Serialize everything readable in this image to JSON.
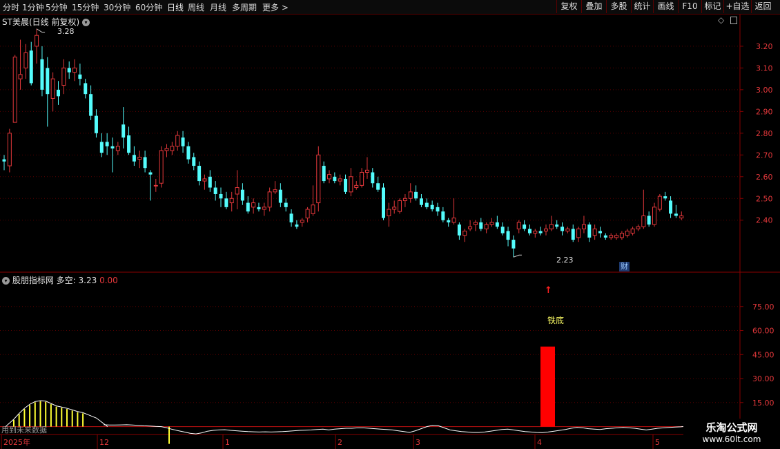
{
  "toolbar": {
    "timeframes": [
      "分时",
      "1分钟",
      "5分钟",
      "15分钟",
      "30分钟",
      "60分钟",
      "日线",
      "周线",
      "月线",
      "多周期",
      "更多 >"
    ],
    "active_timeframe": "日线",
    "right_buttons": [
      "复权",
      "叠加",
      "多股",
      "统计",
      "画线",
      "F10",
      "标记",
      "+自选",
      "返回"
    ]
  },
  "main_panel": {
    "title": "ST美晨(日线 前复权)",
    "price_axis_ticks": [
      "3.20",
      "3.10",
      "3.00",
      "2.90",
      "2.80",
      "2.70",
      "2.60",
      "2.50",
      "2.40"
    ],
    "high_marker": "3.28",
    "low_marker": "2.23",
    "event_badge": "财"
  },
  "indicator_panel": {
    "name": "股朋指标网",
    "series_label": "多空:",
    "value1": "3.23",
    "value2": "0.00",
    "axis_ticks": [
      "75.00",
      "60.00",
      "45.00",
      "30.00",
      "15.00"
    ],
    "signal_label": "铁底",
    "footer_note": "用到未来数据"
  },
  "date_axis": {
    "labels": [
      "2025年",
      "12",
      "1",
      "2",
      "3",
      "4",
      "5"
    ]
  },
  "watermark": {
    "name": "乐淘公式网",
    "url": "www.60lt.com"
  },
  "colors": {
    "up": "#e5383b",
    "down": "#54fcfc",
    "signal_bar": "#ff0000",
    "hist": "#ffff33",
    "line": "#ffffff",
    "grid": "#5a0000",
    "active": "#ffffff"
  },
  "chart_data": {
    "type": "candlestick",
    "ylim": [
      2.18,
      3.33
    ],
    "ohlc": [
      [
        2.68,
        2.7,
        2.63,
        2.67
      ],
      [
        2.65,
        2.82,
        2.62,
        2.8
      ],
      [
        2.85,
        3.16,
        2.85,
        3.15
      ],
      [
        3.05,
        3.23,
        3.0,
        3.07
      ],
      [
        3.1,
        3.21,
        3.05,
        3.17
      ],
      [
        3.18,
        3.22,
        3.02,
        3.03
      ],
      [
        3.2,
        3.28,
        3.12,
        3.25
      ],
      [
        3.14,
        3.2,
        2.97,
        3.0
      ],
      [
        3.1,
        3.15,
        2.83,
        2.98
      ],
      [
        2.96,
        3.08,
        2.9,
        3.05
      ],
      [
        3.0,
        3.04,
        2.93,
        2.97
      ],
      [
        3.02,
        3.14,
        2.98,
        3.1
      ],
      [
        3.1,
        3.13,
        3.05,
        3.08
      ],
      [
        3.08,
        3.14,
        3.04,
        3.1
      ],
      [
        3.07,
        3.12,
        3.02,
        3.05
      ],
      [
        3.03,
        3.05,
        2.96,
        2.98
      ],
      [
        2.98,
        3.02,
        2.86,
        2.88
      ],
      [
        2.88,
        2.91,
        2.78,
        2.8
      ],
      [
        2.76,
        2.8,
        2.69,
        2.71
      ],
      [
        2.76,
        2.8,
        2.7,
        2.74
      ],
      [
        2.74,
        2.78,
        2.62,
        2.73
      ],
      [
        2.72,
        2.76,
        2.7,
        2.74
      ],
      [
        2.84,
        2.92,
        2.73,
        2.78
      ],
      [
        2.79,
        2.83,
        2.7,
        2.71
      ],
      [
        2.7,
        2.74,
        2.65,
        2.67
      ],
      [
        2.68,
        2.72,
        2.64,
        2.69
      ],
      [
        2.69,
        2.72,
        2.62,
        2.64
      ],
      [
        2.62,
        2.63,
        2.49,
        2.61
      ],
      [
        2.56,
        2.59,
        2.53,
        2.56
      ],
      [
        2.57,
        2.74,
        2.55,
        2.72
      ],
      [
        2.72,
        2.75,
        2.69,
        2.73
      ],
      [
        2.72,
        2.76,
        2.7,
        2.74
      ],
      [
        2.74,
        2.81,
        2.72,
        2.79
      ],
      [
        2.78,
        2.81,
        2.71,
        2.74
      ],
      [
        2.74,
        2.76,
        2.66,
        2.68
      ],
      [
        2.69,
        2.71,
        2.63,
        2.65
      ],
      [
        2.65,
        2.67,
        2.56,
        2.58
      ],
      [
        2.58,
        2.61,
        2.54,
        2.59
      ],
      [
        2.6,
        2.63,
        2.53,
        2.55
      ],
      [
        2.55,
        2.58,
        2.49,
        2.52
      ],
      [
        2.52,
        2.55,
        2.46,
        2.5
      ],
      [
        2.5,
        2.53,
        2.45,
        2.46
      ],
      [
        2.48,
        2.53,
        2.44,
        2.5
      ],
      [
        2.52,
        2.63,
        2.45,
        2.55
      ],
      [
        2.54,
        2.57,
        2.47,
        2.49
      ],
      [
        2.48,
        2.51,
        2.43,
        2.44
      ],
      [
        2.46,
        2.5,
        2.43,
        2.48
      ],
      [
        2.46,
        2.48,
        2.44,
        2.45
      ],
      [
        2.45,
        2.48,
        2.42,
        2.46
      ],
      [
        2.46,
        2.55,
        2.44,
        2.53
      ],
      [
        2.53,
        2.58,
        2.52,
        2.54
      ],
      [
        2.54,
        2.57,
        2.46,
        2.48
      ],
      [
        2.48,
        2.5,
        2.44,
        2.46
      ],
      [
        2.43,
        2.45,
        2.37,
        2.39
      ],
      [
        2.38,
        2.4,
        2.36,
        2.37
      ],
      [
        2.39,
        2.41,
        2.37,
        2.4
      ],
      [
        2.41,
        2.46,
        2.39,
        2.45
      ],
      [
        2.43,
        2.56,
        2.42,
        2.47
      ],
      [
        2.48,
        2.74,
        2.44,
        2.7
      ],
      [
        2.65,
        2.67,
        2.57,
        2.58
      ],
      [
        2.59,
        2.63,
        2.57,
        2.61
      ],
      [
        2.6,
        2.62,
        2.57,
        2.58
      ],
      [
        2.58,
        2.61,
        2.56,
        2.59
      ],
      [
        2.59,
        2.61,
        2.52,
        2.53
      ],
      [
        2.53,
        2.64,
        2.51,
        2.6
      ],
      [
        2.55,
        2.58,
        2.54,
        2.56
      ],
      [
        2.56,
        2.64,
        2.55,
        2.62
      ],
      [
        2.62,
        2.69,
        2.59,
        2.63
      ],
      [
        2.62,
        2.64,
        2.55,
        2.57
      ],
      [
        2.57,
        2.6,
        2.53,
        2.54
      ],
      [
        2.55,
        2.57,
        2.4,
        2.41
      ],
      [
        2.42,
        2.48,
        2.37,
        2.45
      ],
      [
        2.45,
        2.49,
        2.43,
        2.46
      ],
      [
        2.44,
        2.5,
        2.43,
        2.49
      ],
      [
        2.49,
        2.52,
        2.46,
        2.5
      ],
      [
        2.5,
        2.57,
        2.48,
        2.53
      ],
      [
        2.53,
        2.56,
        2.49,
        2.5
      ],
      [
        2.5,
        2.52,
        2.46,
        2.47
      ],
      [
        2.48,
        2.5,
        2.45,
        2.46
      ],
      [
        2.47,
        2.49,
        2.44,
        2.45
      ],
      [
        2.46,
        2.48,
        2.42,
        2.44
      ],
      [
        2.44,
        2.46,
        2.39,
        2.4
      ],
      [
        2.4,
        2.41,
        2.37,
        2.39
      ],
      [
        2.39,
        2.5,
        2.38,
        2.41
      ],
      [
        2.38,
        2.39,
        2.31,
        2.33
      ],
      [
        2.33,
        2.36,
        2.3,
        2.35
      ],
      [
        2.36,
        2.4,
        2.35,
        2.37
      ],
      [
        2.38,
        2.4,
        2.35,
        2.39
      ],
      [
        2.39,
        2.41,
        2.35,
        2.36
      ],
      [
        2.36,
        2.39,
        2.34,
        2.38
      ],
      [
        2.38,
        2.41,
        2.37,
        2.39
      ],
      [
        2.39,
        2.42,
        2.36,
        2.37
      ],
      [
        2.37,
        2.39,
        2.33,
        2.34
      ],
      [
        2.35,
        2.37,
        2.28,
        2.31
      ],
      [
        2.31,
        2.33,
        2.23,
        2.27
      ],
      [
        2.36,
        2.4,
        2.34,
        2.39
      ],
      [
        2.38,
        2.4,
        2.35,
        2.36
      ],
      [
        2.36,
        2.38,
        2.33,
        2.34
      ],
      [
        2.34,
        2.36,
        2.32,
        2.35
      ],
      [
        2.35,
        2.37,
        2.33,
        2.34
      ],
      [
        2.35,
        2.38,
        2.33,
        2.36
      ],
      [
        2.36,
        2.42,
        2.35,
        2.38
      ],
      [
        2.38,
        2.4,
        2.36,
        2.37
      ],
      [
        2.37,
        2.39,
        2.33,
        2.35
      ],
      [
        2.35,
        2.37,
        2.34,
        2.36
      ],
      [
        2.36,
        2.38,
        2.3,
        2.31
      ],
      [
        2.32,
        2.37,
        2.3,
        2.36
      ],
      [
        2.36,
        2.42,
        2.34,
        2.38
      ],
      [
        2.38,
        2.39,
        2.3,
        2.32
      ],
      [
        2.33,
        2.38,
        2.31,
        2.36
      ],
      [
        2.35,
        2.37,
        2.32,
        2.34
      ],
      [
        2.33,
        2.34,
        2.31,
        2.32
      ],
      [
        2.32,
        2.34,
        2.31,
        2.33
      ],
      [
        2.32,
        2.34,
        2.31,
        2.33
      ],
      [
        2.32,
        2.35,
        2.31,
        2.34
      ],
      [
        2.33,
        2.36,
        2.32,
        2.35
      ],
      [
        2.34,
        2.37,
        2.33,
        2.36
      ],
      [
        2.36,
        2.38,
        2.35,
        2.37
      ],
      [
        2.37,
        2.54,
        2.36,
        2.42
      ],
      [
        2.42,
        2.44,
        2.37,
        2.38
      ],
      [
        2.38,
        2.48,
        2.37,
        2.46
      ],
      [
        2.45,
        2.52,
        2.44,
        2.51
      ],
      [
        2.51,
        2.53,
        2.49,
        2.5
      ],
      [
        2.49,
        2.51,
        2.41,
        2.43
      ],
      [
        2.43,
        2.47,
        2.41,
        2.42
      ],
      [
        2.41,
        2.44,
        2.4,
        2.42
      ]
    ],
    "indicator": {
      "line": [
        0.45,
        0.4,
        0.38,
        0.42,
        0.45,
        0.4,
        0.3,
        0.2,
        0.15,
        0.05,
        0.0,
        -0.3,
        -0.7,
        -1.0,
        -1.3,
        -1.6,
        -1.75,
        -1.5,
        -1.1,
        -0.9,
        -0.8,
        -0.75,
        -0.9,
        -1.0,
        -1.1,
        -1.2,
        -1.25,
        -1.3,
        -1.25,
        -1.3,
        -1.25,
        -1.2,
        -1.1,
        -1.0,
        -0.9,
        -0.85,
        -0.8,
        -0.7,
        -0.6,
        -0.8,
        -0.6,
        -0.5,
        -0.4,
        -0.4,
        -0.3,
        -0.3,
        -0.4,
        -0.5,
        -0.6,
        -0.7,
        -0.8,
        -1.0,
        -1.2,
        -1.4,
        -1.0,
        -0.5,
        0.0,
        0.3,
        0.2,
        -0.3,
        -0.8,
        -1.0,
        -1.2,
        -1.3,
        -1.4,
        -1.4,
        -1.3,
        -1.1,
        -0.9,
        -0.7,
        -0.6,
        -0.8,
        -1.0,
        -1.2,
        -1.3,
        -1.4,
        -1.45,
        -1.3,
        -1.1,
        -0.9,
        -0.7,
        -0.4,
        -0.2,
        -0.3,
        -0.5,
        -0.6,
        -0.7,
        -0.5,
        -0.4,
        -0.3,
        -0.2,
        -0.3,
        -0.4,
        -0.6,
        -0.8,
        -0.6,
        -0.4,
        -0.3,
        -0.2,
        -0.1,
        -0.05,
        0.1,
        0.6,
        1.0,
        1.3,
        1.6,
        1.4,
        0.8
      ],
      "hist": [
        4.2,
        7.8,
        11.0,
        13.5,
        15.2,
        15.8,
        15.5,
        14.0,
        12.5,
        11.8,
        11.0,
        10.0,
        9.0,
        8.3
      ],
      "signal_value": 50.0,
      "ylim": [
        -4.5,
        90
      ]
    }
  }
}
